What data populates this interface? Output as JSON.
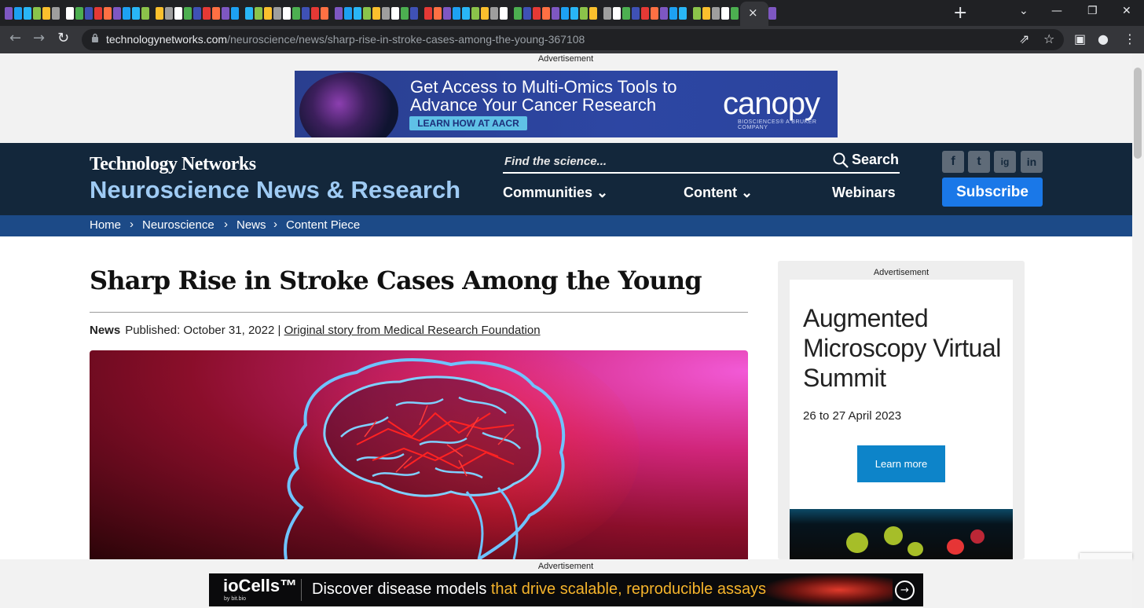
{
  "browser": {
    "tab_close": "×",
    "new_tab": "+",
    "url_host": "technologynetworks.com",
    "url_path": "/neuroscience/news/sharp-rise-in-stroke-cases-among-the-young-367108",
    "icons": [
      "back-arrow-icon",
      "forward-arrow-icon",
      "reload-icon",
      "lock-icon",
      "share-icon",
      "bookmark-star-icon",
      "side-panel-icon",
      "profile-icon",
      "menu-dots-icon"
    ]
  },
  "ads": {
    "label": "Advertisement",
    "top_banner": {
      "headline": "Get Access to Multi-Omics Tools to Advance Your Cancer Research",
      "cta": "LEARN HOW AT AACR",
      "brand": "canopy",
      "brand_sub": "BIOSCIENCES® A BRUKER COMPANY"
    },
    "side_banner": {
      "title": "Augmented Microscopy Virtual Summit",
      "date": "26 to 27 April 2023",
      "cta": "Learn more"
    },
    "bottom_banner": {
      "brand": "ioCells™",
      "brand_sub": "by bit.bio",
      "text_plain": "Discover disease models ",
      "text_highlight": "that drive scalable, reproducible assays"
    }
  },
  "site": {
    "brand": "Technology Networks",
    "section": "Neuroscience News & Research",
    "search_placeholder": "Find the science...",
    "search_label": "Search",
    "nav": [
      "Communities",
      "Content",
      "Webinars"
    ],
    "subscribe": "Subscribe",
    "social": [
      "f",
      "t",
      "ig",
      "in"
    ]
  },
  "breadcrumb": [
    "Home",
    "Neuroscience",
    "News",
    "Content Piece"
  ],
  "article": {
    "title": "Sharp Rise in Stroke Cases Among the Young",
    "type": "News",
    "published": "Published: October 31, 2022 | ",
    "source_link": "Original story from Medical Research Foundation"
  },
  "colors": {
    "header_bg": "#13273b",
    "breadcrumb_bg": "#1c4a87",
    "section_title": "#9fcbf4",
    "subscribe_bg": "#1a78e8"
  }
}
